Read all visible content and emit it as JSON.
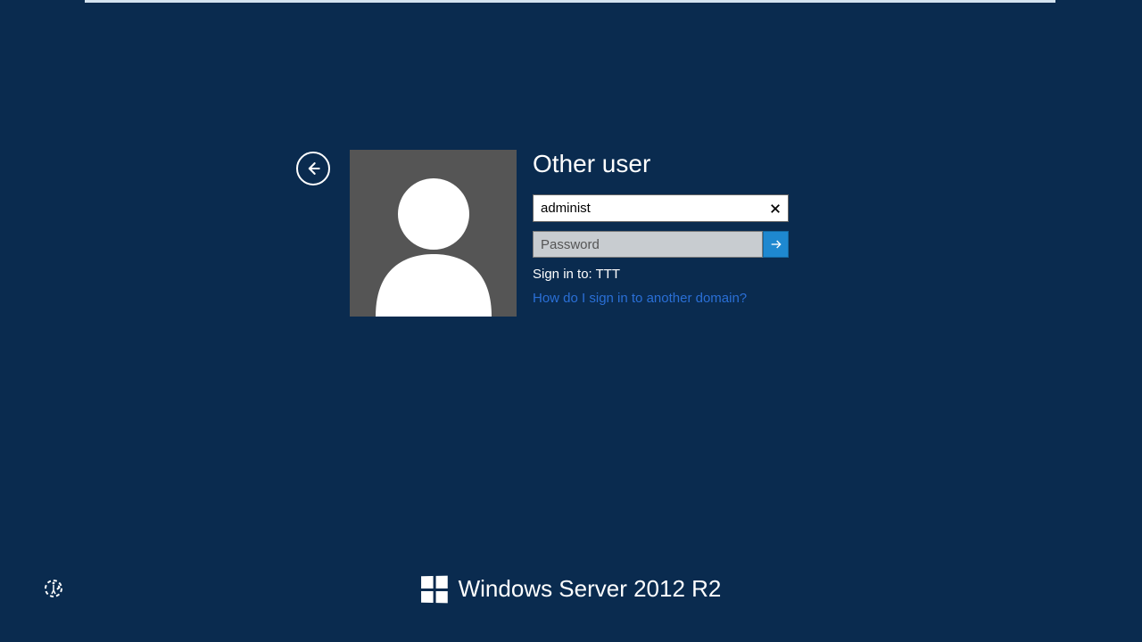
{
  "login": {
    "heading": "Other user",
    "username_value": "administ",
    "password_placeholder": "Password",
    "signin_to_label": "Sign in to: ",
    "signin_to_domain": "TTT",
    "domain_link": "How do I sign in to another domain?"
  },
  "branding": {
    "product": "Windows Server 2012 R2"
  }
}
